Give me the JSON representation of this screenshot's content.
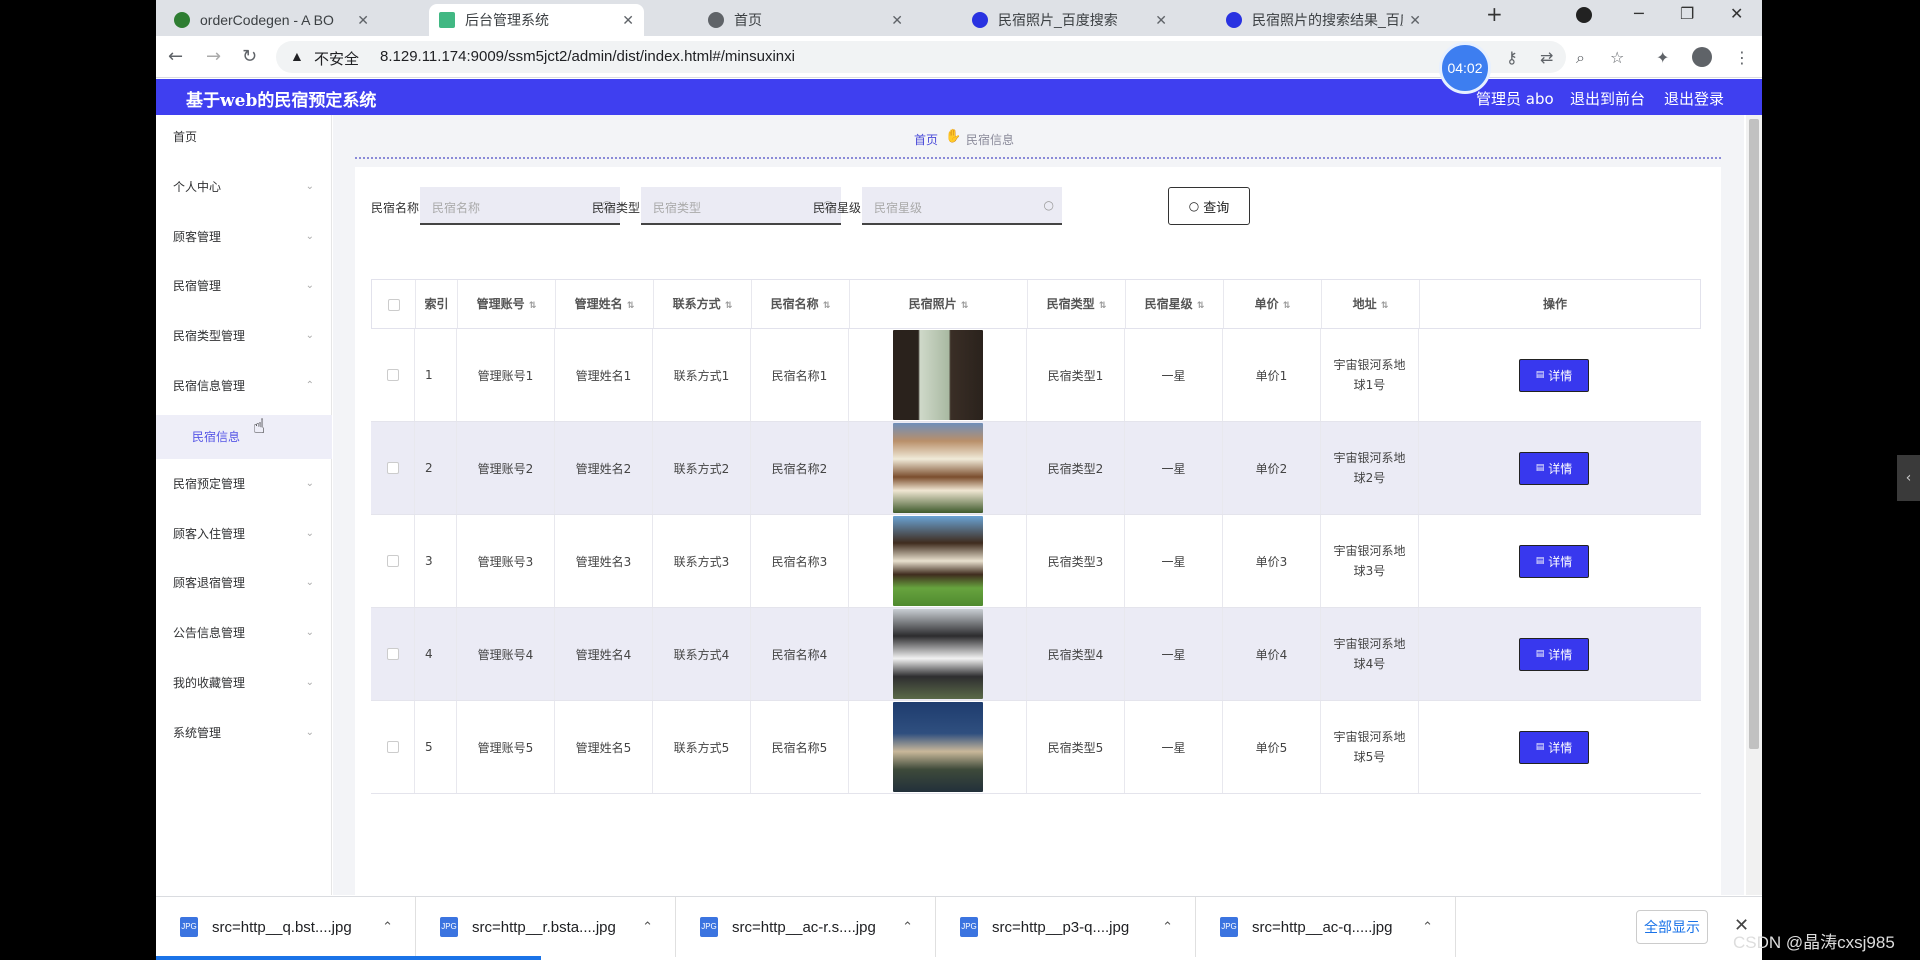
{
  "browser": {
    "tabs": [
      {
        "title": "orderCodegen - A BO",
        "active": false,
        "favicon_color": "#2e7d32"
      },
      {
        "title": "后台管理系统",
        "active": true,
        "favicon_color": "#41b883"
      },
      {
        "title": "首页",
        "active": false,
        "favicon_color": "#5f6368"
      },
      {
        "title": "民宿照片_百度搜索",
        "active": false,
        "favicon_color": "#2932e1"
      },
      {
        "title": "民宿照片的搜索结果_百度图片搜",
        "active": false,
        "favicon_color": "#2932e1"
      }
    ],
    "new_tab": "+",
    "insecure_label": "不安全",
    "url": "8.129.11.174:9009/ssm5jct2/admin/dist/index.html#/minsuxinxi",
    "timer": "04:02"
  },
  "header": {
    "title": "基于web的民宿预定系统",
    "user": "管理员 abo",
    "to_front": "退出到前台",
    "logout": "退出登录",
    "color": "#3f3ff0"
  },
  "sidebar": {
    "items": [
      {
        "label": "首页",
        "chevron": ""
      },
      {
        "label": "个人中心",
        "chevron": "⌄"
      },
      {
        "label": "顾客管理",
        "chevron": "⌄"
      },
      {
        "label": "民宿管理",
        "chevron": "⌄"
      },
      {
        "label": "民宿类型管理",
        "chevron": "⌄"
      },
      {
        "label": "民宿信息管理",
        "chevron": "⌃"
      },
      {
        "label": "民宿信息",
        "chevron": ""
      },
      {
        "label": "民宿预定管理",
        "chevron": "⌄"
      },
      {
        "label": "顾客入住管理",
        "chevron": "⌄"
      },
      {
        "label": "顾客退宿管理",
        "chevron": "⌄"
      },
      {
        "label": "公告信息管理",
        "chevron": "⌄"
      },
      {
        "label": "我的收藏管理",
        "chevron": "⌄"
      },
      {
        "label": "系统管理",
        "chevron": "⌄"
      }
    ]
  },
  "breadcrumb": {
    "home": "首页",
    "current": "民宿信息"
  },
  "search": {
    "name_label": "民宿名称",
    "name_placeholder": "民宿名称",
    "type_label": "民宿类型",
    "type_placeholder": "民宿类型",
    "star_label": "民宿星级",
    "star_placeholder": "民宿星级",
    "query_button": "查询"
  },
  "table": {
    "headers": [
      "索引",
      "管理账号",
      "管理姓名",
      "联系方式",
      "民宿名称",
      "民宿照片",
      "民宿类型",
      "民宿星级",
      "单价",
      "地址",
      "操作"
    ],
    "detail_label": "详情",
    "rows": [
      {
        "index": "1",
        "account": "管理账号1",
        "name": "管理姓名1",
        "contact": "联系方式1",
        "homestay": "民宿名称1",
        "photo": "interior",
        "type": "民宿类型1",
        "star": "一星",
        "price": "单价1",
        "address_line1": "宇宙银河系地",
        "address_line2": "球1号"
      },
      {
        "index": "2",
        "account": "管理账号2",
        "name": "管理姓名2",
        "contact": "联系方式2",
        "homestay": "民宿名称2",
        "photo": "chalet",
        "type": "民宿类型2",
        "star": "一星",
        "price": "单价2",
        "address_line1": "宇宙银河系地",
        "address_line2": "球2号"
      },
      {
        "index": "3",
        "account": "管理账号3",
        "name": "管理姓名3",
        "contact": "联系方式3",
        "homestay": "民宿名称3",
        "photo": "cottage",
        "type": "民宿类型3",
        "star": "一星",
        "price": "单价3",
        "address_line1": "宇宙银河系地",
        "address_line2": "球3号"
      },
      {
        "index": "4",
        "account": "管理账号4",
        "name": "管理姓名4",
        "contact": "联系方式4",
        "homestay": "民宿名称4",
        "photo": "house",
        "type": "民宿类型4",
        "star": "一星",
        "price": "单价4",
        "address_line1": "宇宙银河系地",
        "address_line2": "球4号"
      },
      {
        "index": "5",
        "account": "管理账号5",
        "name": "管理姓名5",
        "contact": "联系方式5",
        "homestay": "民宿名称5",
        "photo": "villa",
        "type": "民宿类型5",
        "star": "一星",
        "price": "单价5",
        "address_line1": "宇宙银河系地",
        "address_line2": "球5号"
      }
    ]
  },
  "downloads": {
    "items": [
      "src=http__q.bst....jpg",
      "src=http__r.bsta....jpg",
      "src=http__ac-r.s....jpg",
      "src=http__p3-q....jpg",
      "src=http__ac-q.....jpg"
    ],
    "show_all": "全部显示"
  },
  "watermark": "CSDN @晶涛cxsj985"
}
